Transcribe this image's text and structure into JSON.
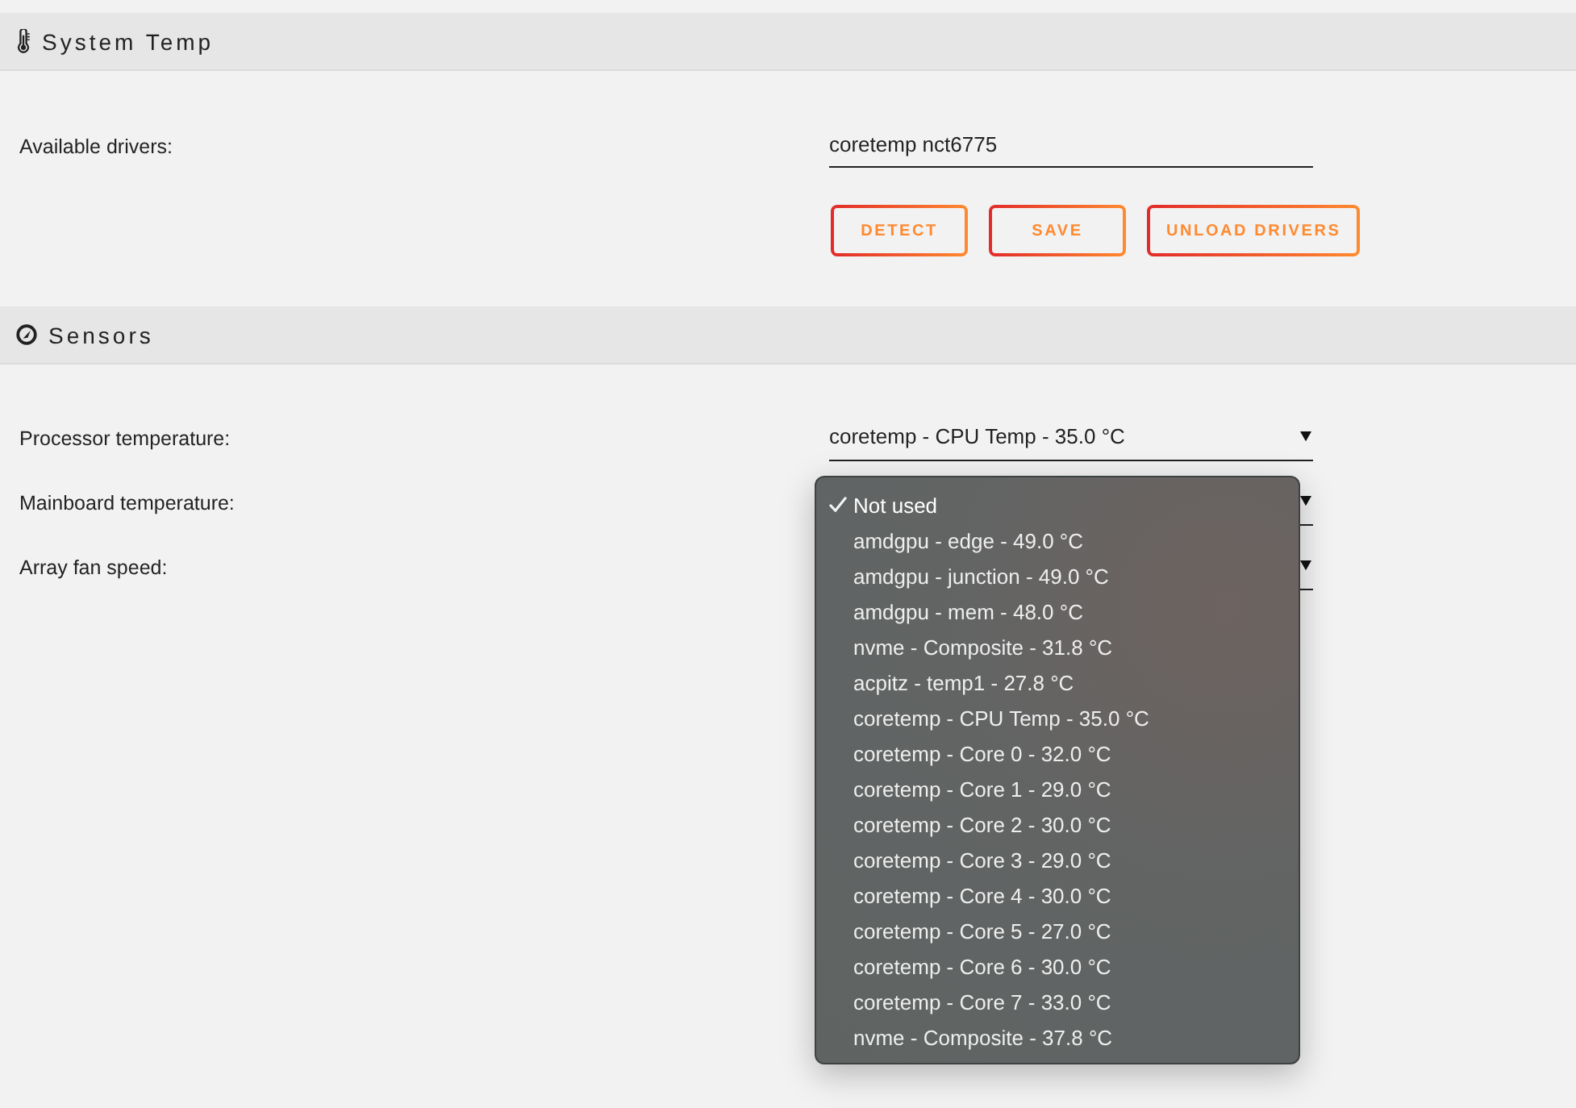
{
  "sections": [
    {
      "kind": "drivers",
      "title": "System Temp",
      "label": "Available drivers:",
      "value": "coretemp nct6775",
      "buttons": [
        "DETECT",
        "SAVE",
        "UNLOAD DRIVERS"
      ]
    },
    {
      "kind": "sensors",
      "title": "Sensors",
      "fields": [
        {
          "label": "Processor temperature:",
          "value": "coretemp - CPU Temp - 35.0 °C"
        },
        {
          "label": "Mainboard temperature:",
          "options": [
            {
              "label": "Not used",
              "selected": true
            },
            {
              "label": "amdgpu - edge - 49.0 °C",
              "selected": false
            },
            {
              "label": "amdgpu - junction - 49.0 °C",
              "selected": false
            },
            {
              "label": "amdgpu - mem - 48.0 °C",
              "selected": false
            },
            {
              "label": "nvme - Composite - 31.8 °C",
              "selected": false
            },
            {
              "label": "acpitz - temp1 - 27.8 °C",
              "selected": false
            },
            {
              "label": "coretemp - CPU Temp - 35.0 °C",
              "selected": false
            },
            {
              "label": "coretemp - Core 0 - 32.0 °C",
              "selected": false
            },
            {
              "label": "coretemp - Core 1 - 29.0 °C",
              "selected": false
            },
            {
              "label": "coretemp - Core 2 - 30.0 °C",
              "selected": false
            },
            {
              "label": "coretemp - Core 3 - 29.0 °C",
              "selected": false
            },
            {
              "label": "coretemp - Core 4 - 30.0 °C",
              "selected": false
            },
            {
              "label": "coretemp - Core 5 - 27.0 °C",
              "selected": false
            },
            {
              "label": "coretemp - Core 6 - 30.0 °C",
              "selected": false
            },
            {
              "label": "coretemp - Core 7 - 33.0 °C",
              "selected": false
            },
            {
              "label": "nvme - Composite - 37.8 °C",
              "selected": false
            }
          ]
        },
        {
          "label": "Array fan speed:"
        }
      ]
    }
  ]
}
